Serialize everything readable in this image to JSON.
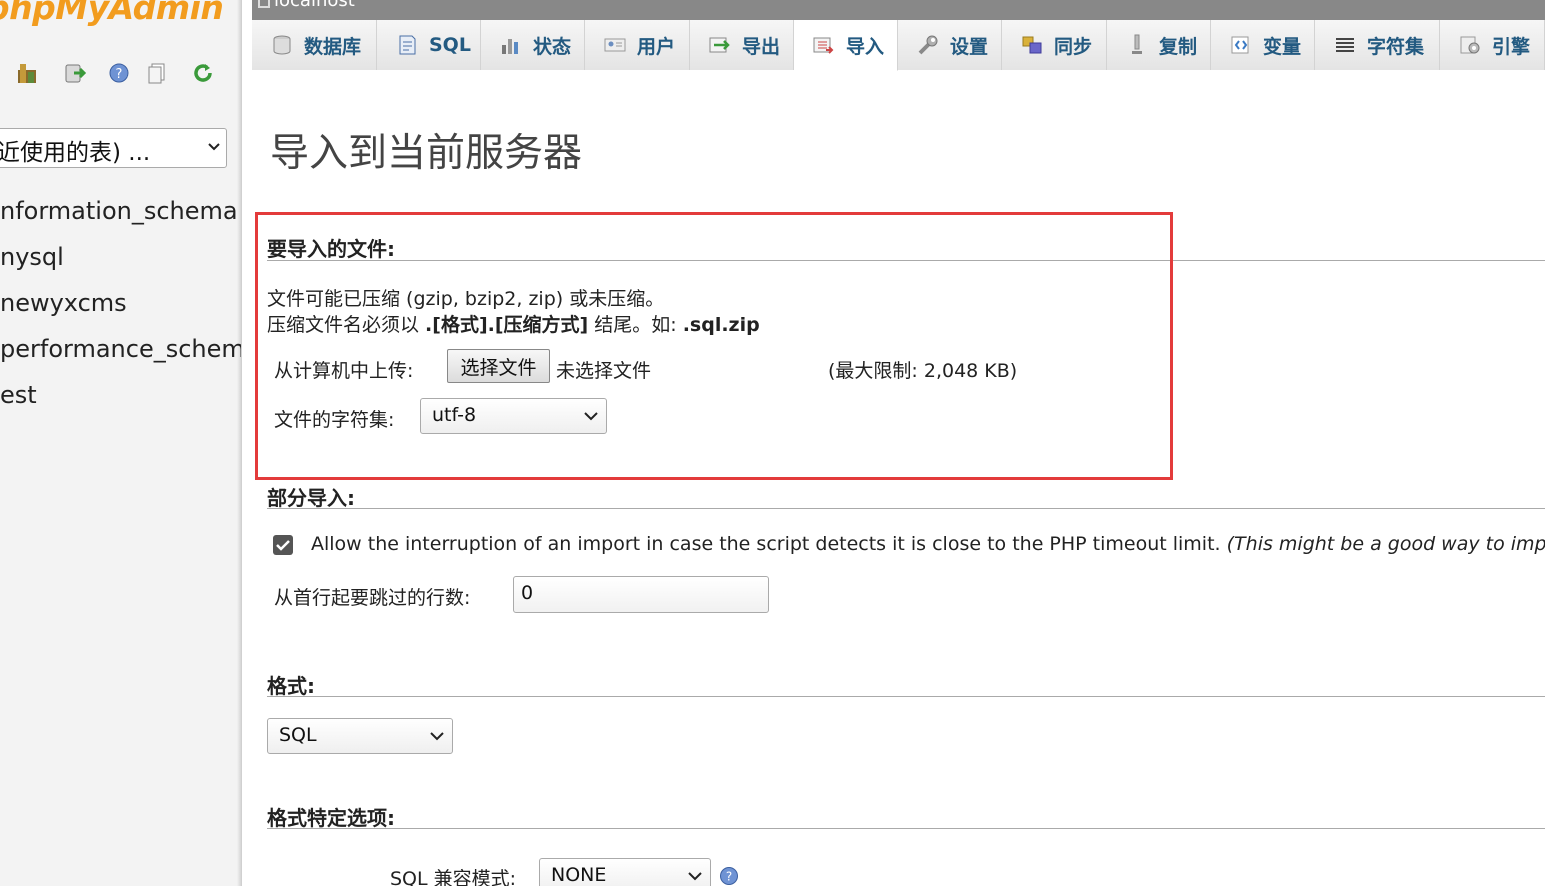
{
  "nav": {
    "logo_text": "phpMyAdmin",
    "recent_select": "近使用的表) ...",
    "databases": [
      {
        "name": "information_schema",
        "visible": "nformation_schema"
      },
      {
        "name": "mysql",
        "visible": "nysql"
      },
      {
        "name": "newyxcms",
        "visible": "newyxcms"
      },
      {
        "name": "performance_schema",
        "visible": "performance_schema"
      },
      {
        "name": "test",
        "visible": "est"
      }
    ]
  },
  "server": {
    "label": "localhost"
  },
  "tabs": [
    {
      "label": "数据库",
      "icon": "database-icon"
    },
    {
      "label": "SQL",
      "icon": "sql-icon"
    },
    {
      "label": "状态",
      "icon": "status-icon"
    },
    {
      "label": "用户",
      "icon": "users-icon"
    },
    {
      "label": "导出",
      "icon": "export-icon"
    },
    {
      "label": "导入",
      "icon": "import-icon",
      "active": true
    },
    {
      "label": "设置",
      "icon": "wrench-icon"
    },
    {
      "label": "同步",
      "icon": "sync-icon"
    },
    {
      "label": "复制",
      "icon": "replication-icon"
    },
    {
      "label": "变量",
      "icon": "variables-icon"
    },
    {
      "label": "字符集",
      "icon": "charset-icon"
    },
    {
      "label": "引擎",
      "icon": "engine-icon"
    }
  ],
  "page": {
    "title": "导入到当前服务器",
    "file_section": {
      "heading": "要导入的文件:",
      "line1": "文件可能已压缩 (gzip, bzip2, zip) 或未压缩。",
      "line2_prefix": "压缩文件名必须以 ",
      "line2_bold": ".[格式].[压缩方式]",
      "line2_mid": " 结尾。如: ",
      "line2_example": ".sql.zip",
      "upload_label": "从计算机中上传:",
      "choose_button": "选择文件",
      "no_file": "未选择文件",
      "max_limit": "(最大限制: 2,048 KB)",
      "charset_label": "文件的字符集:",
      "charset_value": "utf-8"
    },
    "partial_section": {
      "heading": "部分导入:",
      "allow_interrupt_text": "Allow the interruption of an import in case the script detects it is close to the PHP timeout limit.",
      "allow_interrupt_note": "(This might be a good way to impo",
      "allow_interrupt_checked": true,
      "skip_label": "从首行起要跳过的行数:",
      "skip_value": "0"
    },
    "format_section": {
      "heading": "格式:",
      "format_value": "SQL"
    },
    "format_options_section": {
      "heading": "格式特定选项:",
      "compat_label": "SQL 兼容模式:",
      "compat_value": "NONE"
    }
  },
  "colors": {
    "accent": "#235a81",
    "highlight": "#e33b3b",
    "logo": "#f29c1e"
  }
}
